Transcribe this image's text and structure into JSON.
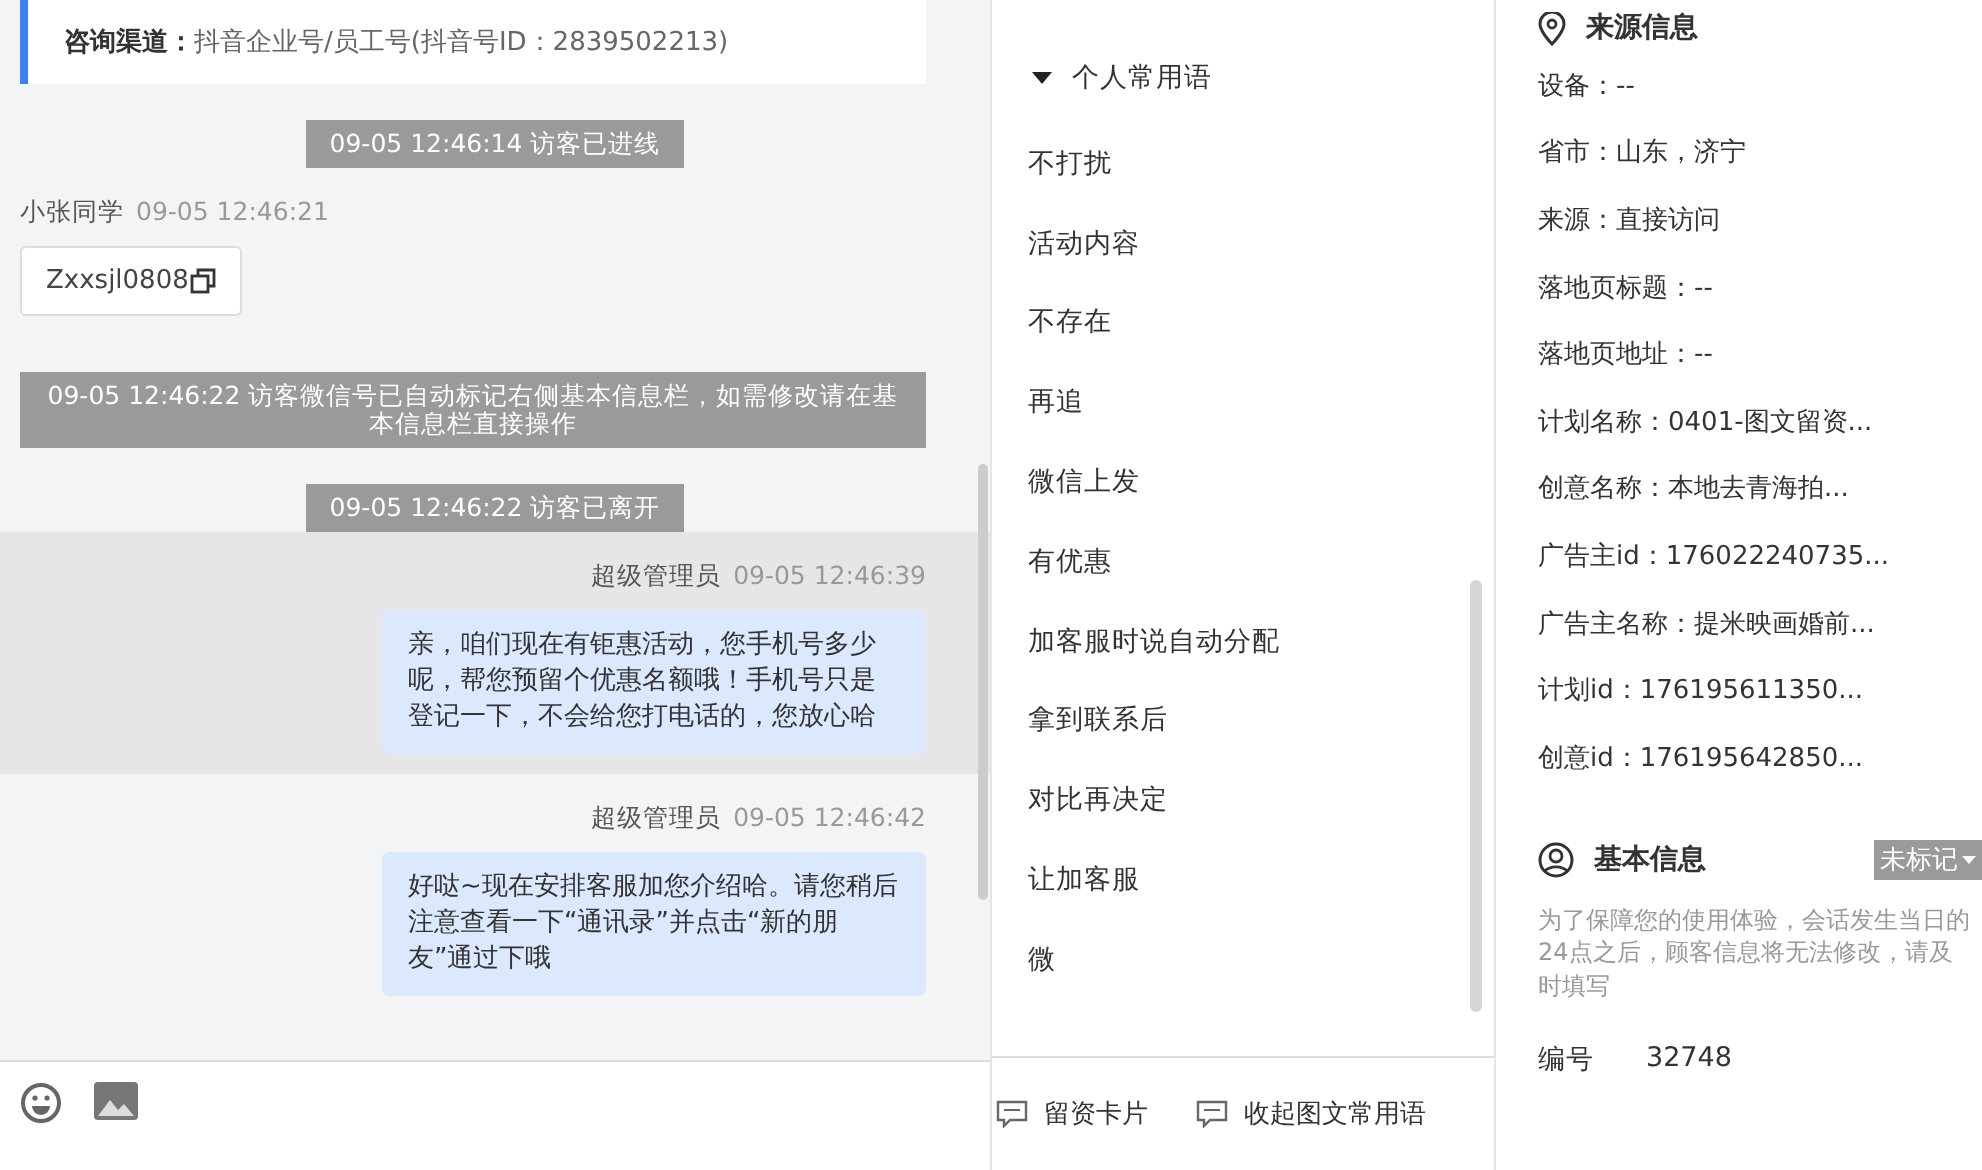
{
  "chat": {
    "channel_label": "咨询渠道：",
    "channel_value": "抖音企业号/员工号(抖音号ID：2839502213)",
    "messages": [
      {
        "kind": "system",
        "text": "09-05 12:46:14 访客已进线"
      },
      {
        "kind": "visitor",
        "name": "小张同学",
        "time": "09-05 12:46:21",
        "text": "Zxxsjl0808"
      },
      {
        "kind": "system",
        "text": "09-05 12:46:22 访客微信号已自动标记右侧基本信息栏，如需修改请在基本信息栏直接操作"
      },
      {
        "kind": "system",
        "text": "09-05 12:46:22 访客已离开"
      },
      {
        "kind": "agent",
        "name": "超级管理员",
        "time": "09-05 12:46:39",
        "text": "亲，咱们现在有钜惠活动，您手机号多少呢，帮您预留个优惠名额哦！手机号只是登记一下，不会给您打电话的，您放心哈",
        "selected": true
      },
      {
        "kind": "agent",
        "name": "超级管理员",
        "time": "09-05 12:46:42",
        "text": "好哒~现在安排客服加您介绍哈。请您稍后注意查看一下“通讯录”并点击“新的朋友”通过下哦",
        "selected": false
      }
    ]
  },
  "phrases": {
    "group": {
      "title": "个人常用语",
      "expanded": true
    },
    "items": [
      "不打扰",
      "活动内容",
      "不存在",
      "再追",
      "微信上发",
      "有优惠",
      "加客服时说自动分配",
      "拿到联系后",
      "对比再决定",
      "让加客服",
      "微"
    ],
    "footer_buttons": [
      "留资卡片",
      "收起图文常用语"
    ]
  },
  "info": {
    "source_title": "来源信息",
    "source_fields": [
      "设备：--",
      "省市：山东，济宁",
      "来源：直接访问",
      "落地页标题：--",
      "落地页地址：--",
      "计划名称：0401-图文留资...",
      "创意名称：本地去青海拍...",
      "广告主id：176022240735...",
      "广告主名称：提米映画婚前...",
      "计划id：176195611350...",
      "创意id：176195642850..."
    ],
    "basic_title": "基本信息",
    "mark_tag": "未标记",
    "notice": "为了保障您的使用体验，会话发生当日的24点之后，顾客信息将无法修改，请及时填写",
    "id_label": "编号",
    "id_value": "32748"
  }
}
